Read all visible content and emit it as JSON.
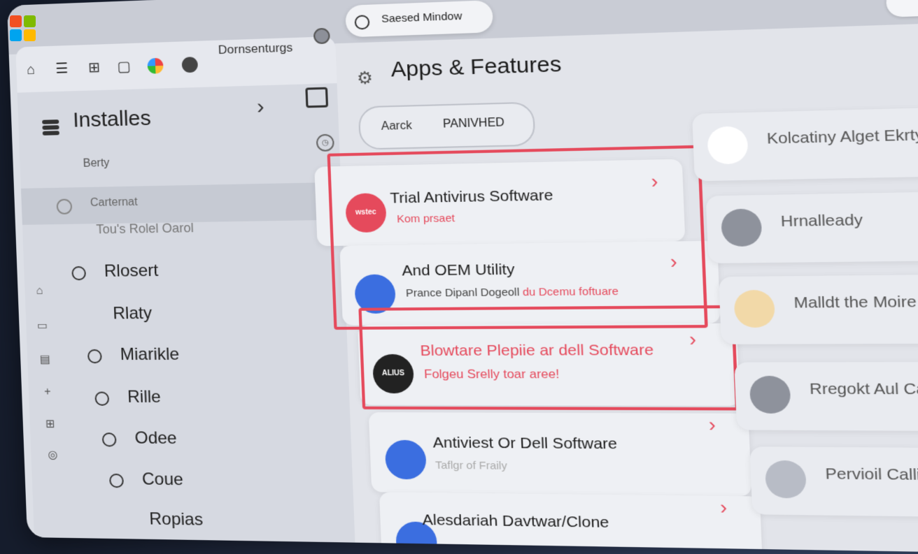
{
  "tabs": {
    "documents_label": "Dornsenturgs",
    "search_window_label": "Saesed Mindow"
  },
  "sidebar": {
    "title": "Installes",
    "subtitle": "Berty",
    "selected_item": "Carternat",
    "section_label": "Tou's Rolel Oarol",
    "items": [
      {
        "label": "Rlosert"
      },
      {
        "label": "Rlaty"
      },
      {
        "label": "Miarikle"
      },
      {
        "label": "Rille"
      },
      {
        "label": "Odee"
      },
      {
        "label": "Coue"
      },
      {
        "label": "Ropias"
      }
    ]
  },
  "main": {
    "title": "Apps & Features",
    "filter_left": "Aarck",
    "filter_right": "PANIVHED",
    "apps": [
      {
        "title": "Trial Antivirus Software",
        "subtitle": "Kom prsaet",
        "icon_text": "wstec",
        "icon_color": "#e54a5c",
        "highlighted": true
      },
      {
        "title": "And OEM Utility",
        "subtitle": "Prance Dipanl Dogeoll",
        "subtitle_highlight": "du Dcemu foftuare",
        "icon_color": "#3b6ee0",
        "highlighted": true
      },
      {
        "title": "Blowtare Plepiie ar dell Software",
        "subtitle": "Folgeu Srelly toar aree!",
        "icon_text": "ALIUS",
        "icon_color": "#222222",
        "highlighted": true
      },
      {
        "title": "Antiviest Or Dell Software",
        "subtitle": "Taflgr of Fraily",
        "icon_color": "#3b6ee0",
        "highlighted": false
      },
      {
        "title": "Alesdariah Davtwar/Clone",
        "subtitle": "",
        "icon_color": "#3b6ee0",
        "highlighted": false
      }
    ],
    "right_apps": [
      {
        "title": "Kolcatiny Alget Ekrty"
      },
      {
        "title": "Hrnalleady"
      },
      {
        "title": "Malldt the Moire"
      },
      {
        "title": "Rregokt Aul Canlac N"
      },
      {
        "title": "Pervioil Callion"
      }
    ]
  },
  "colors": {
    "accent_red": "#e54a5c",
    "accent_blue": "#3b6ee0"
  }
}
